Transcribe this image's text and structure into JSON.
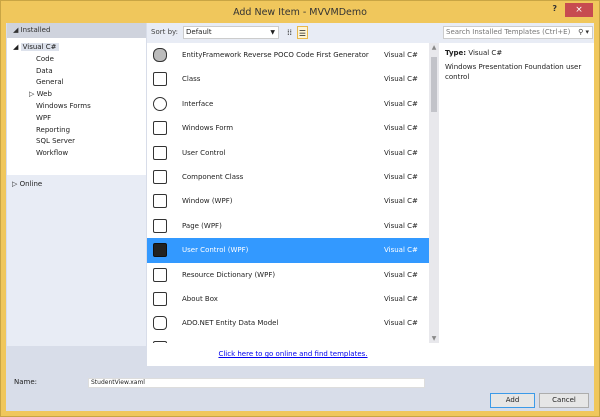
{
  "window": {
    "title": "Add New Item - MVVMDemo",
    "help": "?",
    "close": "×"
  },
  "left": {
    "header": "Installed",
    "root": "Visual C#",
    "items": [
      "Code",
      "Data",
      "General",
      "Web",
      "Windows Forms",
      "WPF",
      "Reporting",
      "SQL Server",
      "Workflow"
    ],
    "online": "Online"
  },
  "toolbar": {
    "sort_label": "Sort by:",
    "sort_value": "Default"
  },
  "templates": [
    {
      "name": "EntityFramework Reverse POCO Code First Generator",
      "type": "Visual C#",
      "icon": "database-icon"
    },
    {
      "name": "Class",
      "type": "Visual C#",
      "icon": "class-icon"
    },
    {
      "name": "Interface",
      "type": "Visual C#",
      "icon": "interface-icon"
    },
    {
      "name": "Windows Form",
      "type": "Visual C#",
      "icon": "windows-form-icon"
    },
    {
      "name": "User Control",
      "type": "Visual C#",
      "icon": "user-control-icon"
    },
    {
      "name": "Component Class",
      "type": "Visual C#",
      "icon": "component-icon"
    },
    {
      "name": "Window (WPF)",
      "type": "Visual C#",
      "icon": "window-icon"
    },
    {
      "name": "Page (WPF)",
      "type": "Visual C#",
      "icon": "page-icon"
    },
    {
      "name": "User Control (WPF)",
      "type": "Visual C#",
      "icon": "user-control-wpf-icon",
      "selected": true
    },
    {
      "name": "Resource Dictionary (WPF)",
      "type": "Visual C#",
      "icon": "dictionary-icon"
    },
    {
      "name": "About Box",
      "type": "Visual C#",
      "icon": "about-box-icon"
    },
    {
      "name": "ADO.NET Entity Data Model",
      "type": "Visual C#",
      "icon": "entity-model-icon"
    }
  ],
  "online_link": "Click here to go online and find templates.",
  "search": {
    "placeholder": "Search Installed Templates (Ctrl+E)"
  },
  "details": {
    "type_label": "Type:",
    "type_value": "Visual C#",
    "description": "Windows Presentation Foundation user control"
  },
  "name_field": {
    "label": "Name:",
    "value": "StudentView.xaml"
  },
  "buttons": {
    "add": "Add",
    "cancel": "Cancel"
  },
  "colors": {
    "selection": "#3399ff",
    "frame": "#f0c75c",
    "close": "#c74b50"
  }
}
